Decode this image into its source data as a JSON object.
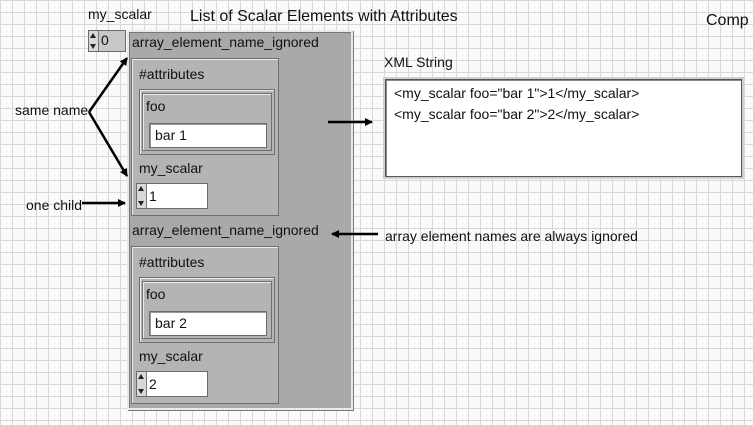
{
  "header": {
    "control_label": "my_scalar",
    "title": "List of Scalar Elements with Attributes",
    "right_label": "Comp"
  },
  "array_index": "0",
  "elements": [
    {
      "element_label": "array_element_name_ignored",
      "attributes_label": "#attributes",
      "attr_name": "foo",
      "attr_value": "bar 1",
      "scalar_label": "my_scalar",
      "scalar_value": "1"
    },
    {
      "element_label": "array_element_name_ignored",
      "attributes_label": "#attributes",
      "attr_name": "foo",
      "attr_value": "bar 2",
      "scalar_label": "my_scalar",
      "scalar_value": "2"
    }
  ],
  "xml": {
    "label": "XML String",
    "lines": [
      "<my_scalar foo=\"bar 1\">1</my_scalar>",
      "<my_scalar foo=\"bar 2\">2</my_scalar>"
    ]
  },
  "annotations": {
    "same_name": "same name",
    "one_child": "one child",
    "ignored_note": "array element names are always ignored"
  }
}
